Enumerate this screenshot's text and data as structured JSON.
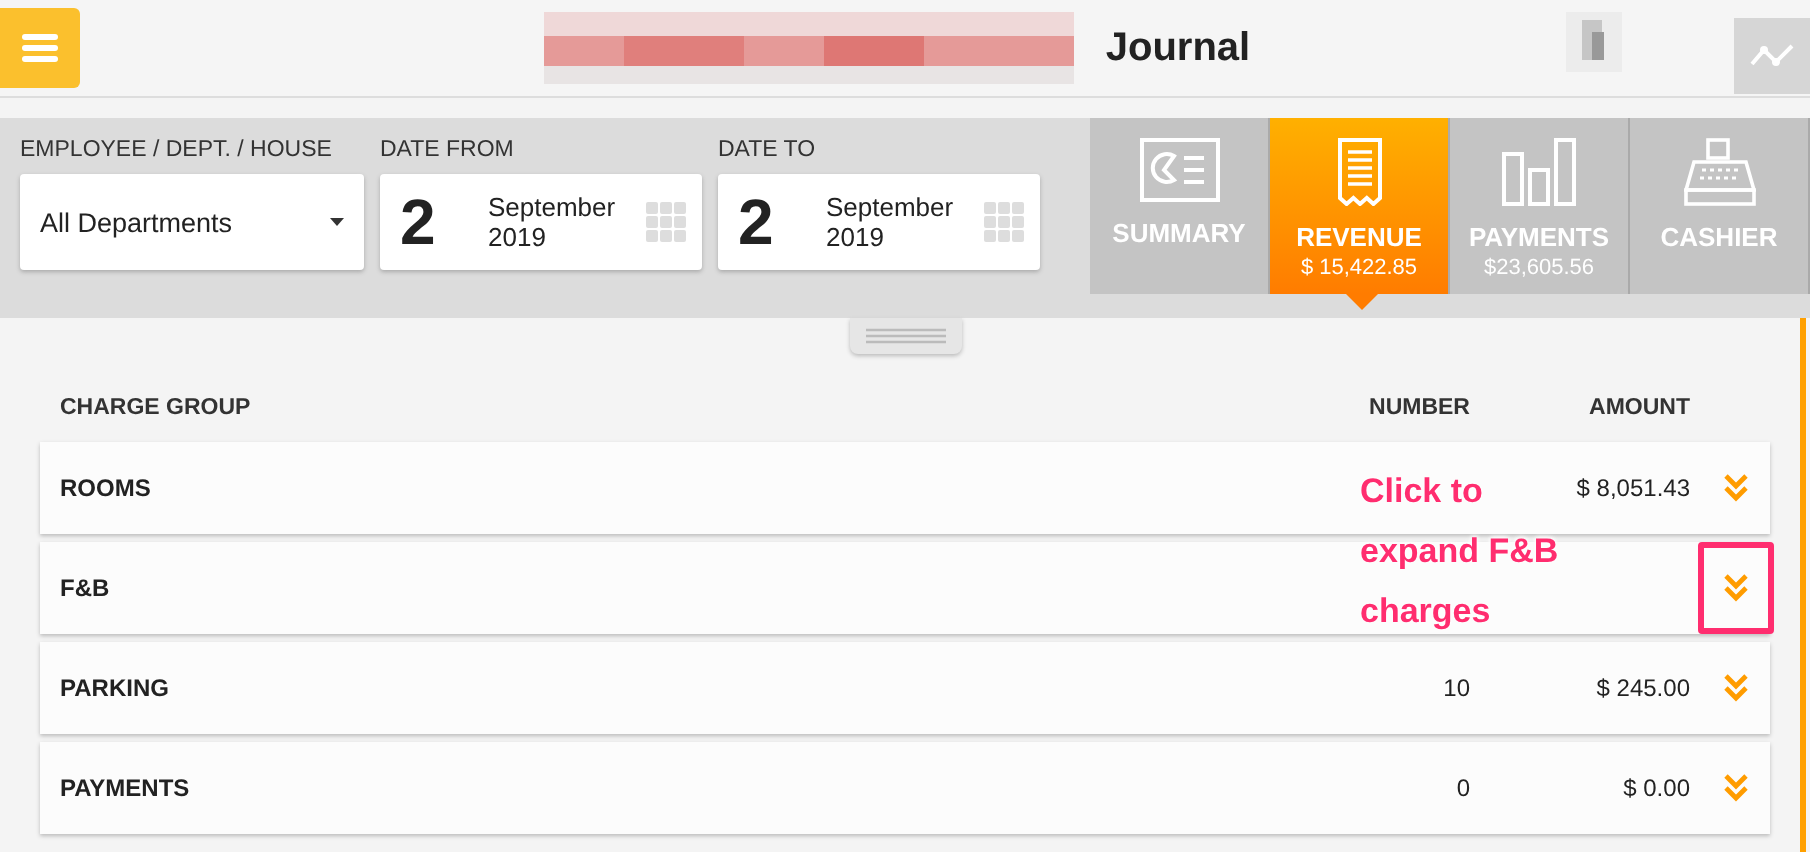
{
  "header": {
    "title": "Journal"
  },
  "filters": {
    "department": {
      "label": "EMPLOYEE / DEPT. / HOUSE",
      "value": "All Departments"
    },
    "date_from": {
      "label": "DATE FROM",
      "day": "2",
      "month": "September",
      "year": "2019"
    },
    "date_to": {
      "label": "DATE TO",
      "day": "2",
      "month": "September",
      "year": "2019"
    }
  },
  "tabs": [
    {
      "kind": "summary",
      "label": "SUMMARY",
      "selected": false
    },
    {
      "kind": "revenue",
      "label": "REVENUE",
      "amount": "$ 15,422.85",
      "selected": true
    },
    {
      "kind": "payments",
      "label": "PAYMENTS",
      "amount": "$23,605.56",
      "selected": false
    },
    {
      "kind": "cashier",
      "label": "CASHIER",
      "selected": false
    }
  ],
  "table": {
    "columns": [
      "CHARGE GROUP",
      "NUMBER",
      "AMOUNT"
    ],
    "rows": [
      {
        "group": "ROOMS",
        "amount": "$ 8,051.43",
        "highlighted": false
      },
      {
        "group": "F&B",
        "highlighted": true
      },
      {
        "group": "PARKING",
        "number": "10",
        "amount": "$ 245.00",
        "highlighted": false
      },
      {
        "group": "PAYMENTS",
        "number": "0",
        "amount": "$ 0.00",
        "highlighted": false
      }
    ]
  },
  "annotation": {
    "text": "Click to expand F&B charges"
  }
}
